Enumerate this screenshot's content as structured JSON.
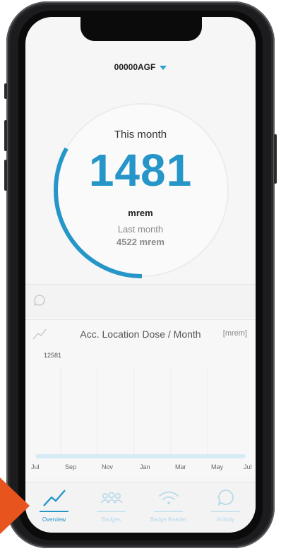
{
  "device": {
    "selected": "00000AGF"
  },
  "gauge": {
    "label": "This month",
    "value": "1481",
    "unit": "mrem",
    "last_label": "Last month",
    "last_value": "4522 mrem",
    "fill_fraction": 0.33,
    "color": "#2596c7"
  },
  "chart": {
    "title": "Acc. Location Dose / Month",
    "unit": "[mrem]",
    "max_label": "12581",
    "x_labels": [
      "Jul",
      "Sep",
      "Nov",
      "Jan",
      "Mar",
      "May",
      "Jul"
    ]
  },
  "tabs": [
    {
      "label": "Overview",
      "icon": "trend-icon",
      "active": true
    },
    {
      "label": "Badges",
      "icon": "users-icon",
      "active": false
    },
    {
      "label": "Badge Reader",
      "icon": "wifi-icon",
      "active": false
    },
    {
      "label": "Activity",
      "icon": "chat-bubble-icon",
      "active": false
    }
  ],
  "colors": {
    "accent": "#2596c7",
    "arrow": "#e8541e"
  }
}
